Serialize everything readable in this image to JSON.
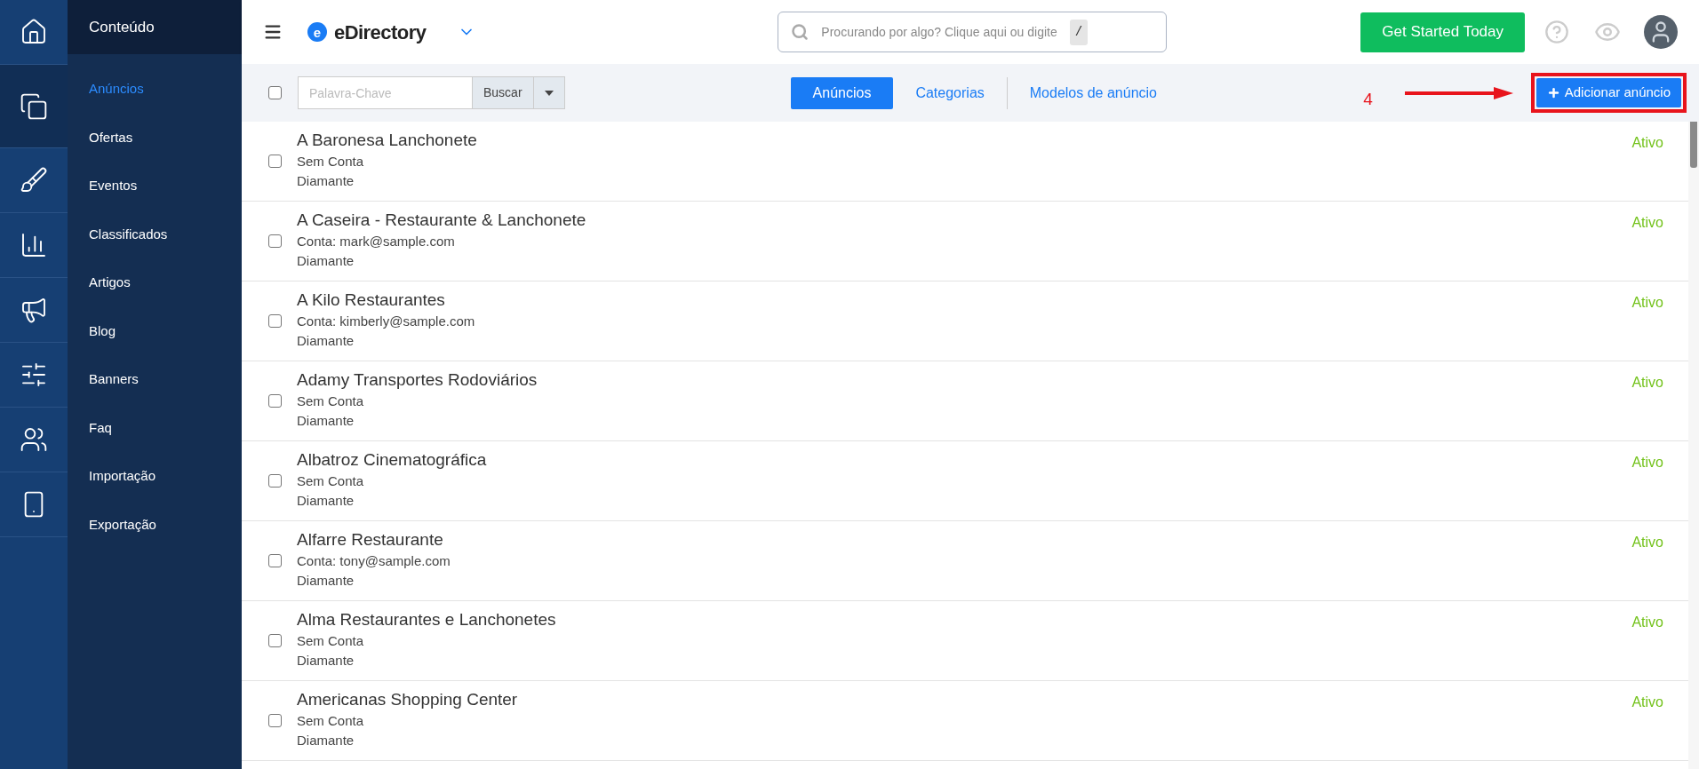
{
  "rail": [
    {
      "kind": "home",
      "selected": false
    },
    {
      "kind": "content",
      "selected": true
    },
    {
      "kind": "design",
      "selected": false
    },
    {
      "kind": "reports",
      "selected": false
    },
    {
      "kind": "promote",
      "selected": false
    },
    {
      "kind": "settings",
      "selected": false
    },
    {
      "kind": "users",
      "selected": false
    },
    {
      "kind": "mobile",
      "selected": false
    }
  ],
  "sidebar": {
    "title": "Conteúdo",
    "items": [
      {
        "label": "Anúncios",
        "selected": true
      },
      {
        "label": "Ofertas",
        "selected": false
      },
      {
        "label": "Eventos",
        "selected": false
      },
      {
        "label": "Classificados",
        "selected": false
      },
      {
        "label": "Artigos",
        "selected": false
      },
      {
        "label": "Blog",
        "selected": false
      },
      {
        "label": "Banners",
        "selected": false
      },
      {
        "label": "Faq",
        "selected": false
      },
      {
        "label": "Importação",
        "selected": false
      },
      {
        "label": "Exportação",
        "selected": false
      }
    ]
  },
  "topbar": {
    "logo_letter": "e",
    "brand": "eDirectory",
    "search_placeholder": "Procurando por algo? Clique aqui ou digite",
    "search_key": "/",
    "cta": "Get Started Today"
  },
  "toolbar": {
    "select_all_checked": false,
    "keyword_placeholder": "Palavra-Chave",
    "search_button": "Buscar",
    "tabs": [
      {
        "label": "Anúncios",
        "selected": true
      },
      {
        "label": "Categorias",
        "selected": false
      },
      {
        "label": "Modelos de anúncio",
        "selected": false
      }
    ],
    "annotation_number": "4",
    "add_button": "Adicionar anúncio"
  },
  "listings": [
    {
      "title": "A Baronesa Lanchonete",
      "account": "Sem Conta",
      "level": "Diamante",
      "status": "Ativo",
      "checked": false
    },
    {
      "title": "A Caseira - Restaurante & Lanchonete",
      "account": "Conta: mark@sample.com",
      "level": "Diamante",
      "status": "Ativo",
      "checked": false
    },
    {
      "title": "A Kilo Restaurantes",
      "account": "Conta: kimberly@sample.com",
      "level": "Diamante",
      "status": "Ativo",
      "checked": false
    },
    {
      "title": "Adamy Transportes Rodoviários",
      "account": "Sem Conta",
      "level": "Diamante",
      "status": "Ativo",
      "checked": false
    },
    {
      "title": "Albatroz Cinematográfica",
      "account": "Sem Conta",
      "level": "Diamante",
      "status": "Ativo",
      "checked": false
    },
    {
      "title": "Alfarre Restaurante",
      "account": "Conta: tony@sample.com",
      "level": "Diamante",
      "status": "Ativo",
      "checked": false
    },
    {
      "title": "Alma Restaurantes e Lanchonetes",
      "account": "Sem Conta",
      "level": "Diamante",
      "status": "Ativo",
      "checked": false
    },
    {
      "title": "Americanas Shopping Center",
      "account": "Sem Conta",
      "level": "Diamante",
      "status": "Ativo",
      "checked": false
    }
  ]
}
